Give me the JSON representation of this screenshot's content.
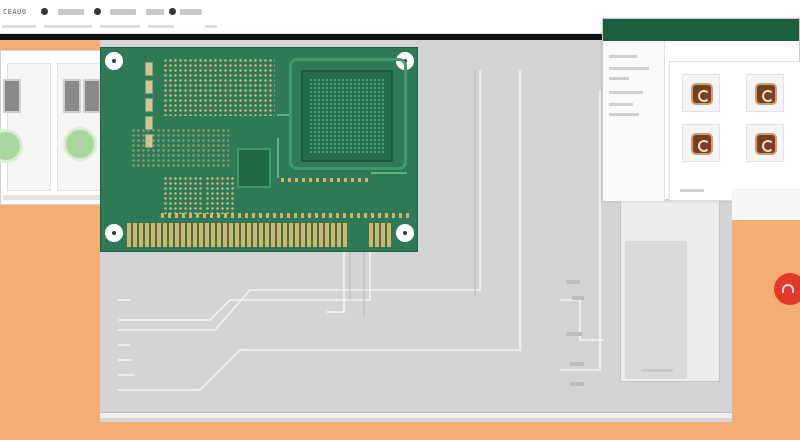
{
  "app": {
    "brand_text": "CEAU0"
  },
  "topbar": {
    "items": [
      "file-menu",
      "edit-menu",
      "view-menu",
      "tools-menu",
      "help-menu"
    ]
  },
  "colors": {
    "background": "#f4ad73",
    "workspace": "#d4d4d4",
    "pcb": "#2f7a56",
    "gold_pad": "#d9b26a",
    "titlebar": "#1e5e40",
    "badge": "#e23a2a"
  },
  "icons": {
    "badge": "notification-icon",
    "thumbnail": "component-icon",
    "mounting_hole": "mounting-hole-icon",
    "status_dot": "status-dot-icon"
  },
  "right_window": {
    "thumbnail_count": 4
  }
}
